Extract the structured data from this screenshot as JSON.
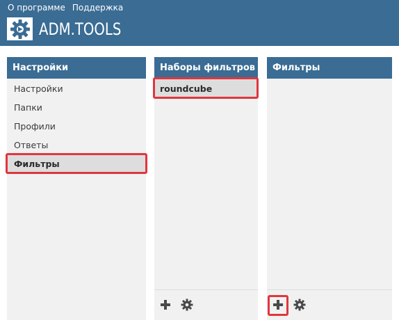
{
  "top_nav": {
    "about": "О программе",
    "support": "Поддержка"
  },
  "logo": {
    "text": "ADM.TOOLS"
  },
  "settings_panel": {
    "title": "Настройки",
    "items": [
      {
        "label": "Настройки"
      },
      {
        "label": "Папки"
      },
      {
        "label": "Профили"
      },
      {
        "label": "Ответы"
      },
      {
        "label": "Фильтры",
        "active": true
      }
    ]
  },
  "filter_sets_panel": {
    "title": "Наборы фильтров",
    "items": [
      {
        "label": "roundcube",
        "active": true
      }
    ],
    "add_icon": "plus-icon",
    "settings_icon": "gear-icon"
  },
  "filters_panel": {
    "title": "Фильтры",
    "items": [],
    "add_icon": "plus-icon",
    "settings_icon": "gear-icon"
  },
  "colors": {
    "header_bg": "#3a6c94",
    "panel_bg": "#f1f1f1",
    "selected_bg": "#dddddd",
    "highlight": "#e0363e",
    "icon": "#4a4a4a"
  }
}
